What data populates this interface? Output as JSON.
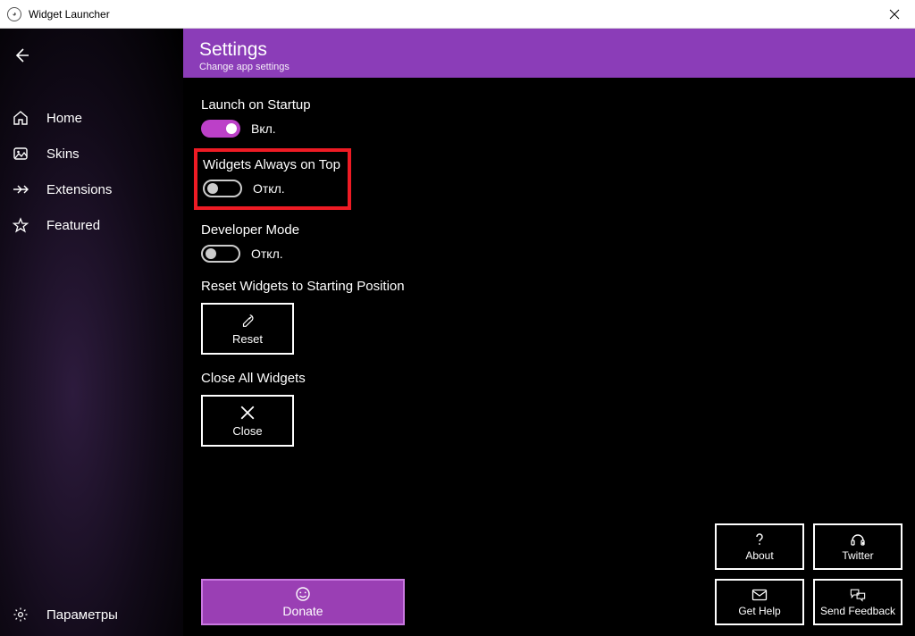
{
  "window": {
    "title": "Widget Launcher"
  },
  "sidebar": {
    "items": [
      {
        "label": "Home"
      },
      {
        "label": "Skins"
      },
      {
        "label": "Extensions"
      },
      {
        "label": "Featured"
      }
    ],
    "footer_label": "Параметры"
  },
  "header": {
    "title": "Settings",
    "subtitle": "Change app settings"
  },
  "settings": {
    "launch_startup": {
      "label": "Launch on Startup",
      "state": "Вкл.",
      "on": true
    },
    "always_on_top": {
      "label": "Widgets Always on Top",
      "state": "Откл.",
      "on": false
    },
    "developer_mode": {
      "label": "Developer Mode",
      "state": "Откл.",
      "on": false
    },
    "reset": {
      "label": "Reset Widgets to Starting Position",
      "button": "Reset"
    },
    "close_all": {
      "label": "Close All Widgets",
      "button": "Close"
    }
  },
  "footer": {
    "donate": "Donate",
    "about": "About",
    "twitter": "Twitter",
    "get_help": "Get Help",
    "send_feedback": "Send Feedback"
  }
}
